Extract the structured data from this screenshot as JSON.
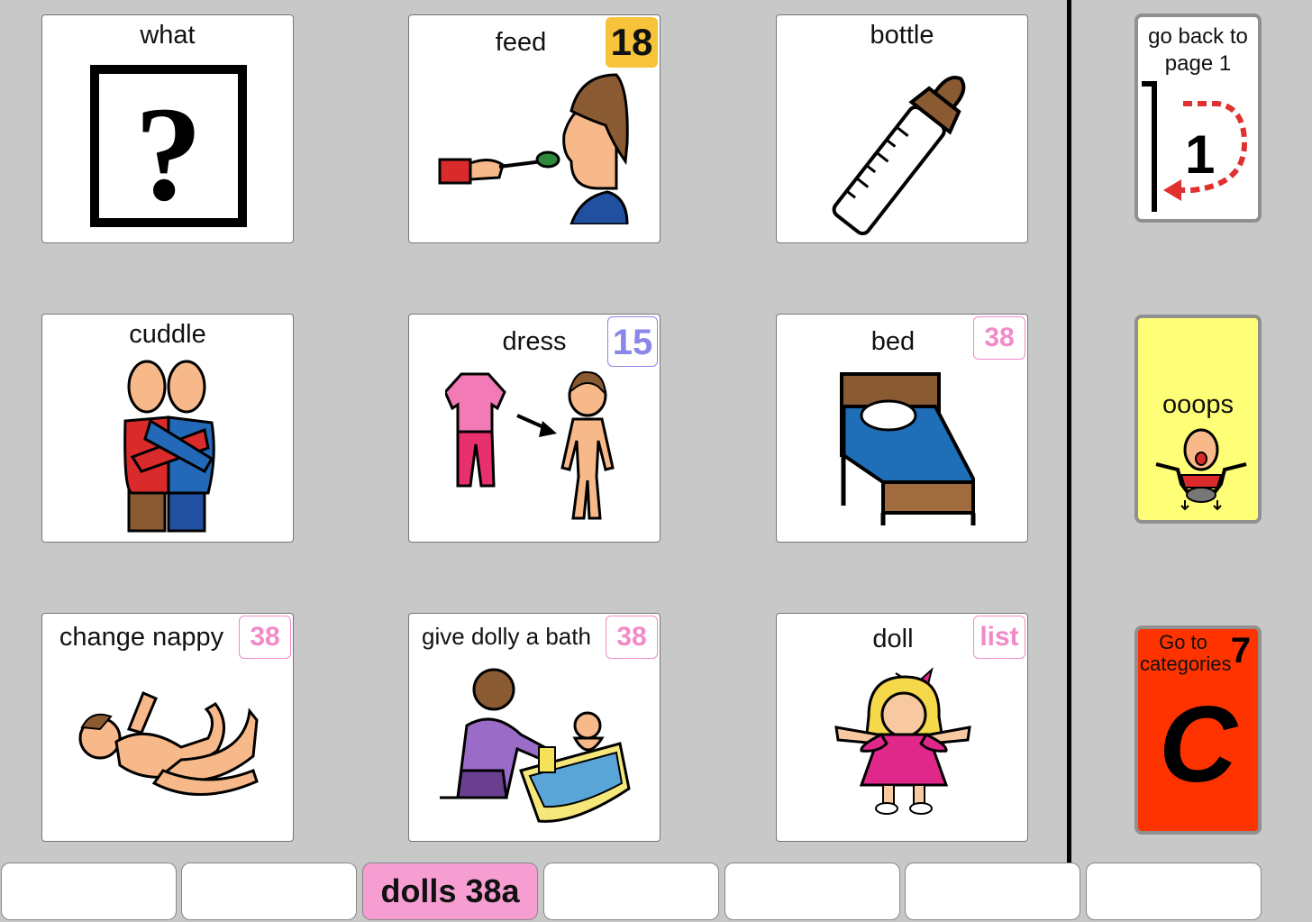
{
  "grid": {
    "cells": [
      {
        "label": "what",
        "badge": ""
      },
      {
        "label": "feed",
        "badge": "18"
      },
      {
        "label": "bottle",
        "badge": ""
      },
      {
        "label": "cuddle",
        "badge": ""
      },
      {
        "label": "dress",
        "badge": "15"
      },
      {
        "label": "bed",
        "badge": "38"
      },
      {
        "label": "change nappy",
        "badge": "38"
      },
      {
        "label": "give dolly a bath",
        "badge": "38"
      },
      {
        "label": "doll",
        "badge": "list"
      }
    ]
  },
  "sidebar": {
    "back": {
      "label_line1": "go back to",
      "label_line2": "page 1",
      "number": "1"
    },
    "oops": {
      "label": "ooops"
    },
    "categories": {
      "label_line1": "Go to",
      "label_line2": "categories",
      "number": "7",
      "letter": "C"
    }
  },
  "tabs": [
    "",
    "",
    "dolls 38a",
    "",
    "",
    "",
    ""
  ],
  "colors": {
    "background": "#c8c8c8",
    "badge_yellow": "#f7c33a",
    "badge_purple": "#8b86ea",
    "badge_pink": "#f28ac8",
    "oops_yellow": "#ffff77",
    "categories_red": "#ff3300",
    "active_tab": "#f69ed2"
  }
}
